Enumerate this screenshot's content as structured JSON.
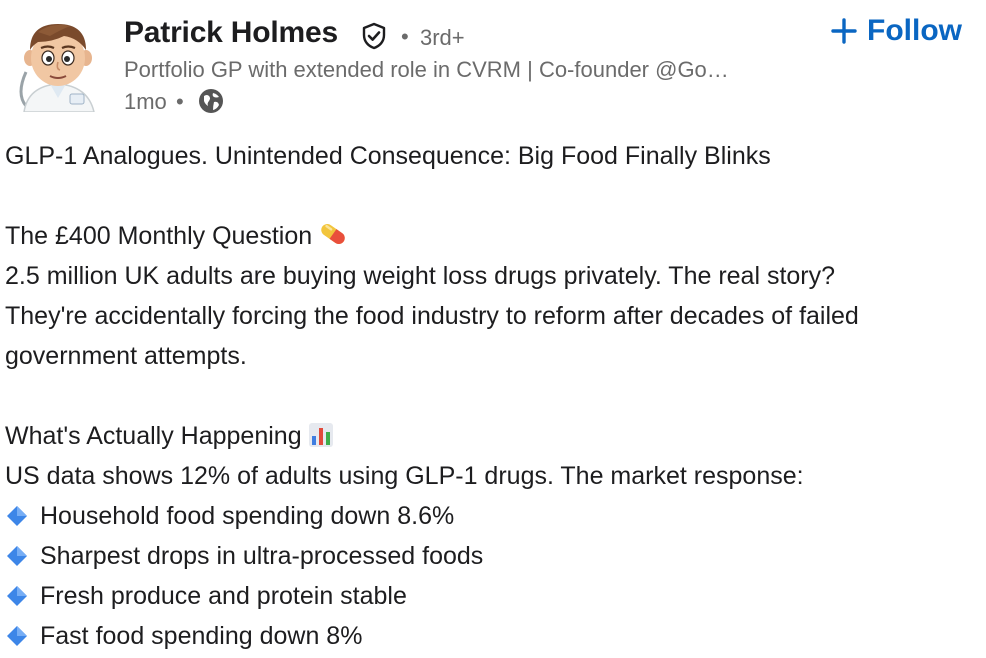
{
  "author": {
    "name": "Patrick Holmes",
    "degree": "3rd+",
    "headline": "Portfolio GP with extended role in CVRM | Co-founder @Go…",
    "posted": "1mo",
    "verified_icon": "verified-shield-icon",
    "visibility_icon": "globe-icon"
  },
  "follow": {
    "label": "Follow",
    "icon": "plus-icon",
    "color": "#0a66c2"
  },
  "post": {
    "title": "GLP-1 Analogues. Unintended Consequence: Big Food Finally Blinks",
    "section1": {
      "heading": "The £400 Monthly Question",
      "emoji": "pill-icon",
      "paragraph_lines": [
        "2.5 million UK adults are buying weight loss drugs privately. The real story?",
        "They're accidentally forcing the food industry to reform after decades of failed",
        "government attempts."
      ]
    },
    "section2": {
      "heading": "What's Actually Happening",
      "emoji": "bar-chart-icon",
      "intro": "US data shows 12% of adults using GLP-1 drugs. The market response:",
      "bullets": [
        "Household food spending down 8.6%",
        "Sharpest drops in ultra-processed foods",
        "Fresh produce and protein stable",
        "Fast food spending down 8%"
      ],
      "bullet_icon": "small-blue-diamond-icon"
    }
  },
  "colors": {
    "text": "#1d1d1f",
    "muted": "#6b6b6b",
    "accent": "#0a66c2"
  }
}
